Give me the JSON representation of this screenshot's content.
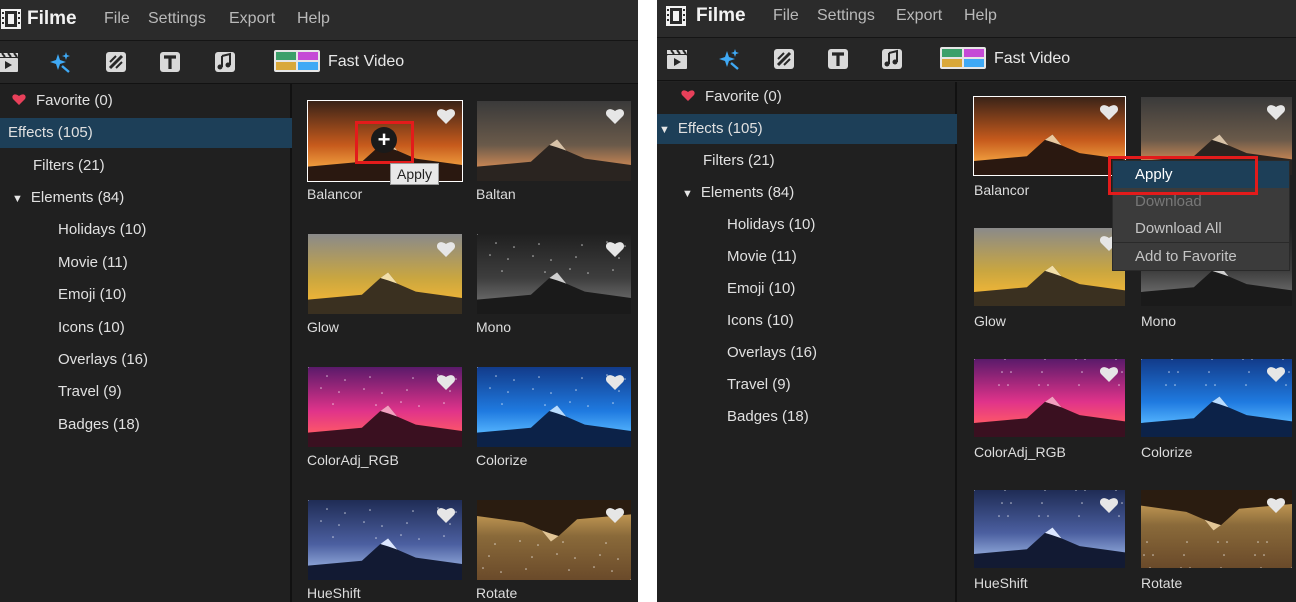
{
  "app": {
    "title": "Filme"
  },
  "menu": [
    "File",
    "Settings",
    "Export",
    "Help"
  ],
  "toolbar": {
    "icons": [
      "clapperboard-icon",
      "effects-sparkle-icon",
      "transition-icon",
      "text-icon",
      "music-note-icon"
    ],
    "fast_video_label": "Fast Video"
  },
  "sidebar": {
    "items": [
      {
        "label": "Favorite (0)"
      },
      {
        "label": "Effects (105)"
      },
      {
        "label": "Filters (21)"
      },
      {
        "label": "Elements (84)"
      },
      {
        "label": "Holidays (10)"
      },
      {
        "label": "Movie (11)"
      },
      {
        "label": "Emoji (10)"
      },
      {
        "label": "Icons (10)"
      },
      {
        "label": "Overlays (16)"
      },
      {
        "label": "Travel (9)"
      },
      {
        "label": "Badges (18)"
      }
    ]
  },
  "effects": [
    {
      "name": "Balancor",
      "theme": "orange"
    },
    {
      "name": "Baltan",
      "theme": "dusk"
    },
    {
      "name": "Glow",
      "theme": "golden"
    },
    {
      "name": "Mono",
      "theme": "mono"
    },
    {
      "name": "ColorAdj_RGB",
      "theme": "magenta"
    },
    {
      "name": "Colorize",
      "theme": "blue"
    },
    {
      "name": "HueShift",
      "theme": "hueshift"
    },
    {
      "name": "Rotate",
      "theme": "rotate"
    }
  ],
  "tooltip": {
    "label": "Apply"
  },
  "context_menu": {
    "items": [
      {
        "label": "Apply",
        "state": "active"
      },
      {
        "label": "Download",
        "state": "disabled"
      },
      {
        "label": "Download All",
        "state": "normal"
      },
      {
        "label": "Add to Favorite",
        "state": "normal"
      }
    ]
  },
  "colors": {
    "accent": "#3fa9f5",
    "selection": "#1d3f58",
    "highlight_box": "#e31b1b",
    "favorite_heart": "#e8405a"
  }
}
